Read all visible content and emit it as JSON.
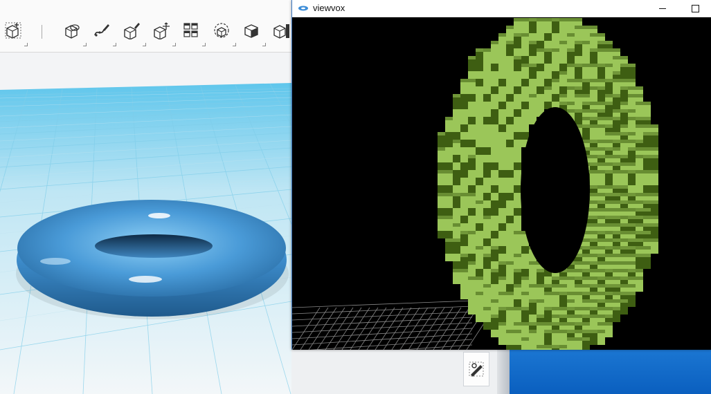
{
  "modeler": {
    "toolbar": {
      "tools": [
        {
          "name": "add-primitive",
          "icon": "cube-add-icon"
        },
        {
          "name": "modify",
          "icon": "cube-lasso-icon"
        },
        {
          "name": "sculpt",
          "icon": "brush-path-icon"
        },
        {
          "name": "paint",
          "icon": "cube-brush-icon"
        },
        {
          "name": "transform",
          "icon": "cube-arrows-icon"
        },
        {
          "name": "pattern",
          "icon": "cubes-grid-icon"
        },
        {
          "name": "snap",
          "icon": "cube-target-icon"
        },
        {
          "name": "material",
          "icon": "cube-solid-icon"
        },
        {
          "name": "measure",
          "icon": "cube-ruler-icon"
        }
      ]
    },
    "scene": {
      "object": "torus",
      "object_color": "#4a9bd8",
      "grid_color": "#7fd3ef"
    }
  },
  "viewvox": {
    "title": "viewvox",
    "min_label": "—",
    "max_label": "☐",
    "background": "#000000",
    "voxel_colors": {
      "light": "#9bc659",
      "dark": "#3e5e12"
    },
    "grid_color": "#8a8a8a"
  },
  "desktop": {
    "accent": "#0a64c8",
    "floating_tool_icon": "pen-ruler-icon"
  }
}
